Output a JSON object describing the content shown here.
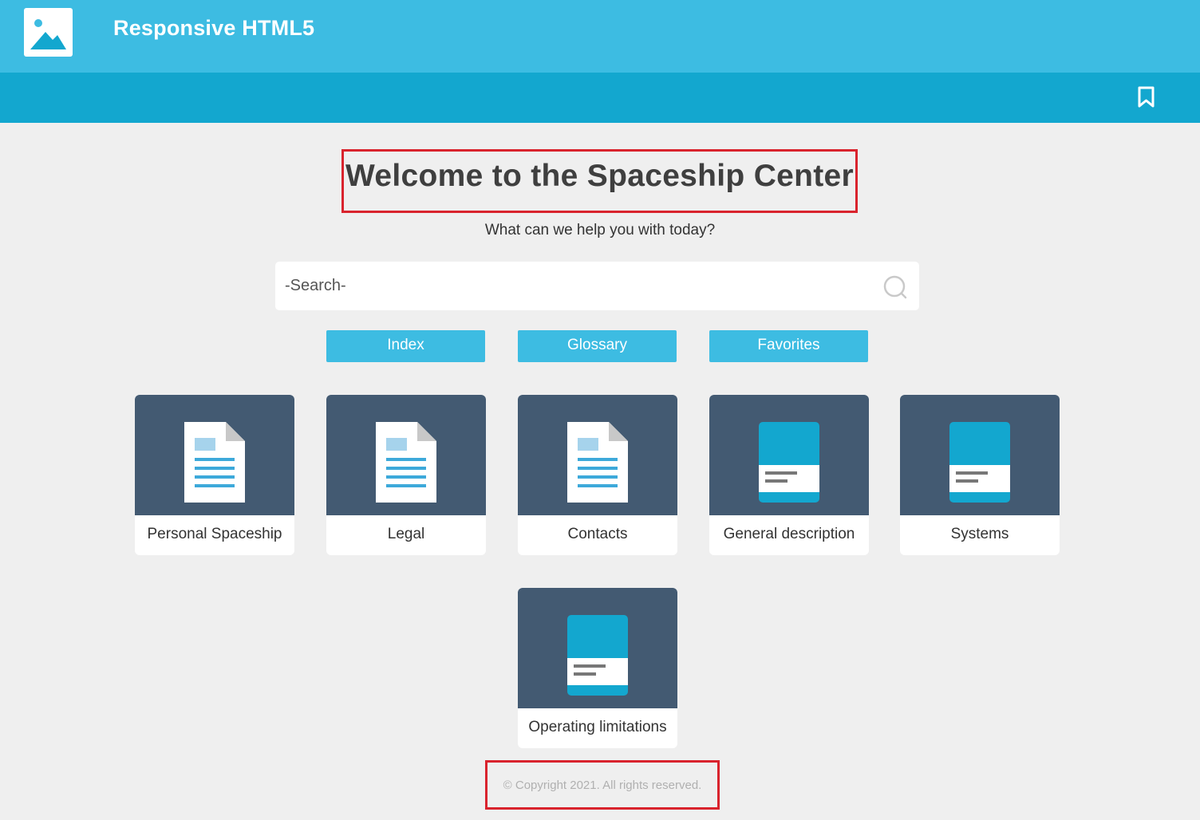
{
  "header": {
    "brand": "Responsive HTML5",
    "logo_icon": "image-placeholder-icon",
    "bookmark_icon": "bookmark-icon"
  },
  "main": {
    "title": "Welcome to the Spaceship Center",
    "subtitle": "What can we help you with today?",
    "search": {
      "placeholder": "-Search-",
      "icon": "search-icon"
    },
    "buttons": [
      {
        "label": "Index"
      },
      {
        "label": "Glossary"
      },
      {
        "label": "Favorites"
      }
    ],
    "tiles": [
      {
        "label": "Personal Spaceship",
        "icon": "document-icon"
      },
      {
        "label": "Legal",
        "icon": "document-icon"
      },
      {
        "label": "Contacts",
        "icon": "document-icon"
      },
      {
        "label": "General description",
        "icon": "book-icon"
      },
      {
        "label": "Systems",
        "icon": "book-icon"
      },
      {
        "label": "Operating limitations",
        "icon": "book-icon"
      }
    ]
  },
  "footer": {
    "copyright": "© Copyright 2021. All rights reserved."
  },
  "colors": {
    "topbar": "#3dbce2",
    "subbar": "#13a7cf",
    "tile_art": "#435a72",
    "highlight": "#d9232d"
  }
}
